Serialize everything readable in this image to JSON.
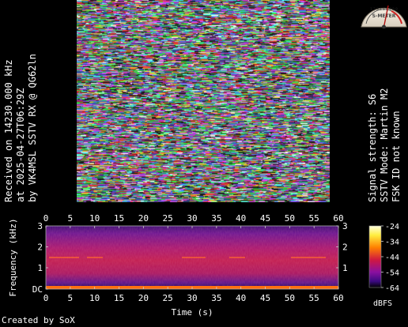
{
  "left_info": {
    "line1": "Received on  14230.000 kHz",
    "line2": "at 2025-04-27T06:29Z",
    "line3": "by VK4MSL SSTV RX @ QG62ln"
  },
  "right_info": {
    "line1": "Signal strength: S6",
    "line2": "SSTV Mode: Martin M2",
    "line3": "FSK ID not known"
  },
  "spectrogram": {
    "y_label": "Frequency (kHz)",
    "x_label": "Time (s)",
    "x_ticks": [
      "0",
      "5",
      "10",
      "15",
      "20",
      "25",
      "30",
      "35",
      "40",
      "45",
      "50",
      "55",
      "60"
    ],
    "y_ticks": [
      "3",
      "2",
      "1",
      "DC"
    ],
    "y_ticks_right": [
      "3",
      "2",
      "1"
    ],
    "colorbar_ticks": [
      "-24",
      "-34",
      "-44",
      "-54",
      "-64"
    ],
    "colorbar_unit": "dBFS"
  },
  "meter": {
    "label": "S-METER",
    "scale": "1 2 3 4 5 6 7 8 9"
  },
  "footer": "Created by SoX"
}
